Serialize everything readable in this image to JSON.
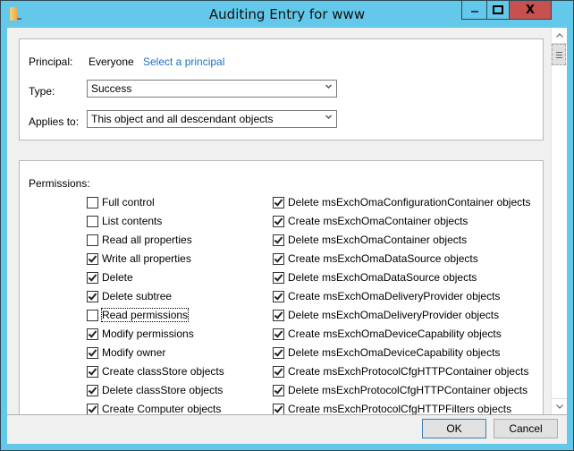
{
  "window": {
    "title": "Auditing Entry for www",
    "controls": {
      "minimize": "minimize",
      "maximize": "maximize",
      "close": "X"
    }
  },
  "principal": {
    "label": "Principal:",
    "value": "Everyone",
    "link": "Select a principal"
  },
  "type": {
    "label": "Type:",
    "selected": "Success"
  },
  "applies_to": {
    "label": "Applies to:",
    "selected": "This object and all descendant objects"
  },
  "permissions": {
    "label": "Permissions:",
    "left": [
      {
        "label": "Full control",
        "checked": false
      },
      {
        "label": "List contents",
        "checked": false
      },
      {
        "label": "Read all properties",
        "checked": false
      },
      {
        "label": "Write all properties",
        "checked": true
      },
      {
        "label": "Delete",
        "checked": true
      },
      {
        "label": "Delete subtree",
        "checked": true
      },
      {
        "label": "Read permissions",
        "checked": false,
        "focused": true
      },
      {
        "label": "Modify permissions",
        "checked": true
      },
      {
        "label": "Modify owner",
        "checked": true
      },
      {
        "label": "Create classStore objects",
        "checked": true
      },
      {
        "label": "Delete classStore objects",
        "checked": true
      },
      {
        "label": "Create Computer objects",
        "checked": true
      }
    ],
    "right": [
      {
        "label": "Delete msExchOmaConfigurationContainer objects",
        "checked": true
      },
      {
        "label": "Create msExchOmaContainer objects",
        "checked": true
      },
      {
        "label": "Delete msExchOmaContainer objects",
        "checked": true
      },
      {
        "label": "Create msExchOmaDataSource objects",
        "checked": true
      },
      {
        "label": "Delete msExchOmaDataSource objects",
        "checked": true
      },
      {
        "label": "Create msExchOmaDeliveryProvider objects",
        "checked": true
      },
      {
        "label": "Delete msExchOmaDeliveryProvider objects",
        "checked": true
      },
      {
        "label": "Create msExchOmaDeviceCapability objects",
        "checked": true
      },
      {
        "label": "Delete msExchOmaDeviceCapability objects",
        "checked": true
      },
      {
        "label": "Create msExchProtocolCfgHTTPContainer objects",
        "checked": true
      },
      {
        "label": "Delete msExchProtocolCfgHTTPContainer objects",
        "checked": true
      },
      {
        "label": "Create msExchProtocolCfgHTTPFilters objects",
        "checked": true
      }
    ]
  },
  "buttons": {
    "ok": "OK",
    "cancel": "Cancel"
  },
  "colors": {
    "titlebar": "#63c8ea",
    "close_button": "#c75050",
    "link": "#1f6fc5"
  }
}
